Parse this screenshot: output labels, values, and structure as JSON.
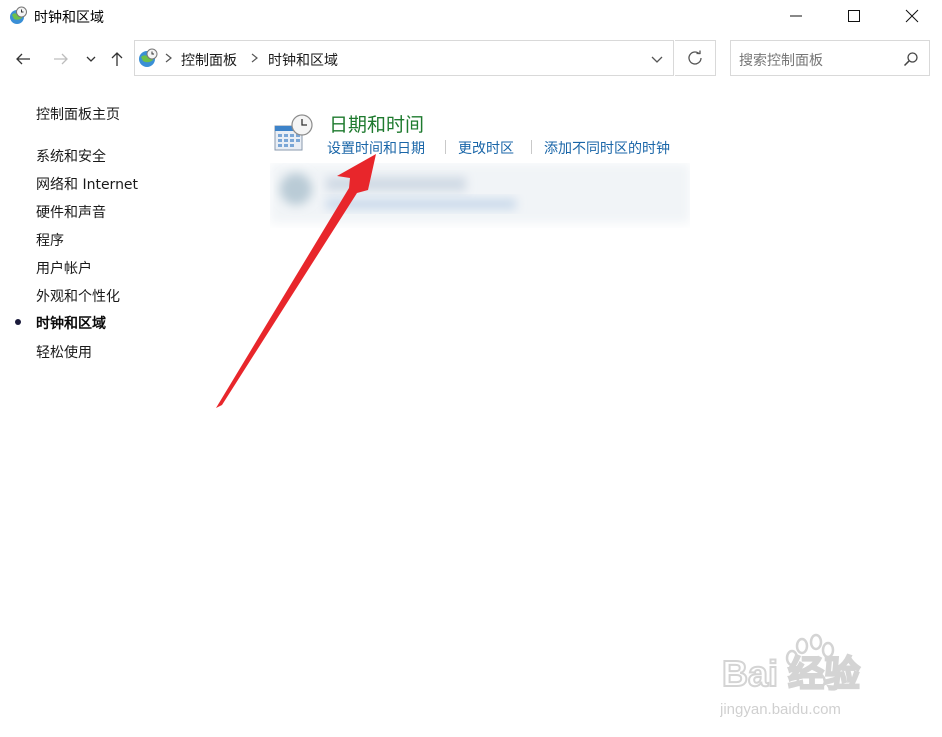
{
  "window": {
    "title": "时钟和区域",
    "controls": [
      "minimize",
      "maximize",
      "close"
    ]
  },
  "navigation": {
    "breadcrumb": [
      "控制面板",
      "时钟和区域"
    ],
    "search_placeholder": "搜索控制面板"
  },
  "sidebar": {
    "home_label": "控制面板主页",
    "items": [
      {
        "label": "系统和安全",
        "active": false
      },
      {
        "label": "网络和 Internet",
        "active": false
      },
      {
        "label": "硬件和声音",
        "active": false
      },
      {
        "label": "程序",
        "active": false
      },
      {
        "label": "用户帐户",
        "active": false
      },
      {
        "label": "外观和个性化",
        "active": false
      },
      {
        "label": "时钟和区域",
        "active": true
      },
      {
        "label": "轻松使用",
        "active": false
      }
    ]
  },
  "main": {
    "category": {
      "title": "日期和时间",
      "icon": "date-time-icon",
      "links": [
        "设置时间和日期",
        "更改时区",
        "添加不同时区的时钟"
      ]
    }
  },
  "watermark": {
    "brand": "Bai 经验",
    "url": "jingyan.baidu.com"
  },
  "colors": {
    "category_title": "#1e7a2e",
    "link": "#1a66a8",
    "arrow": "#e8262b"
  }
}
